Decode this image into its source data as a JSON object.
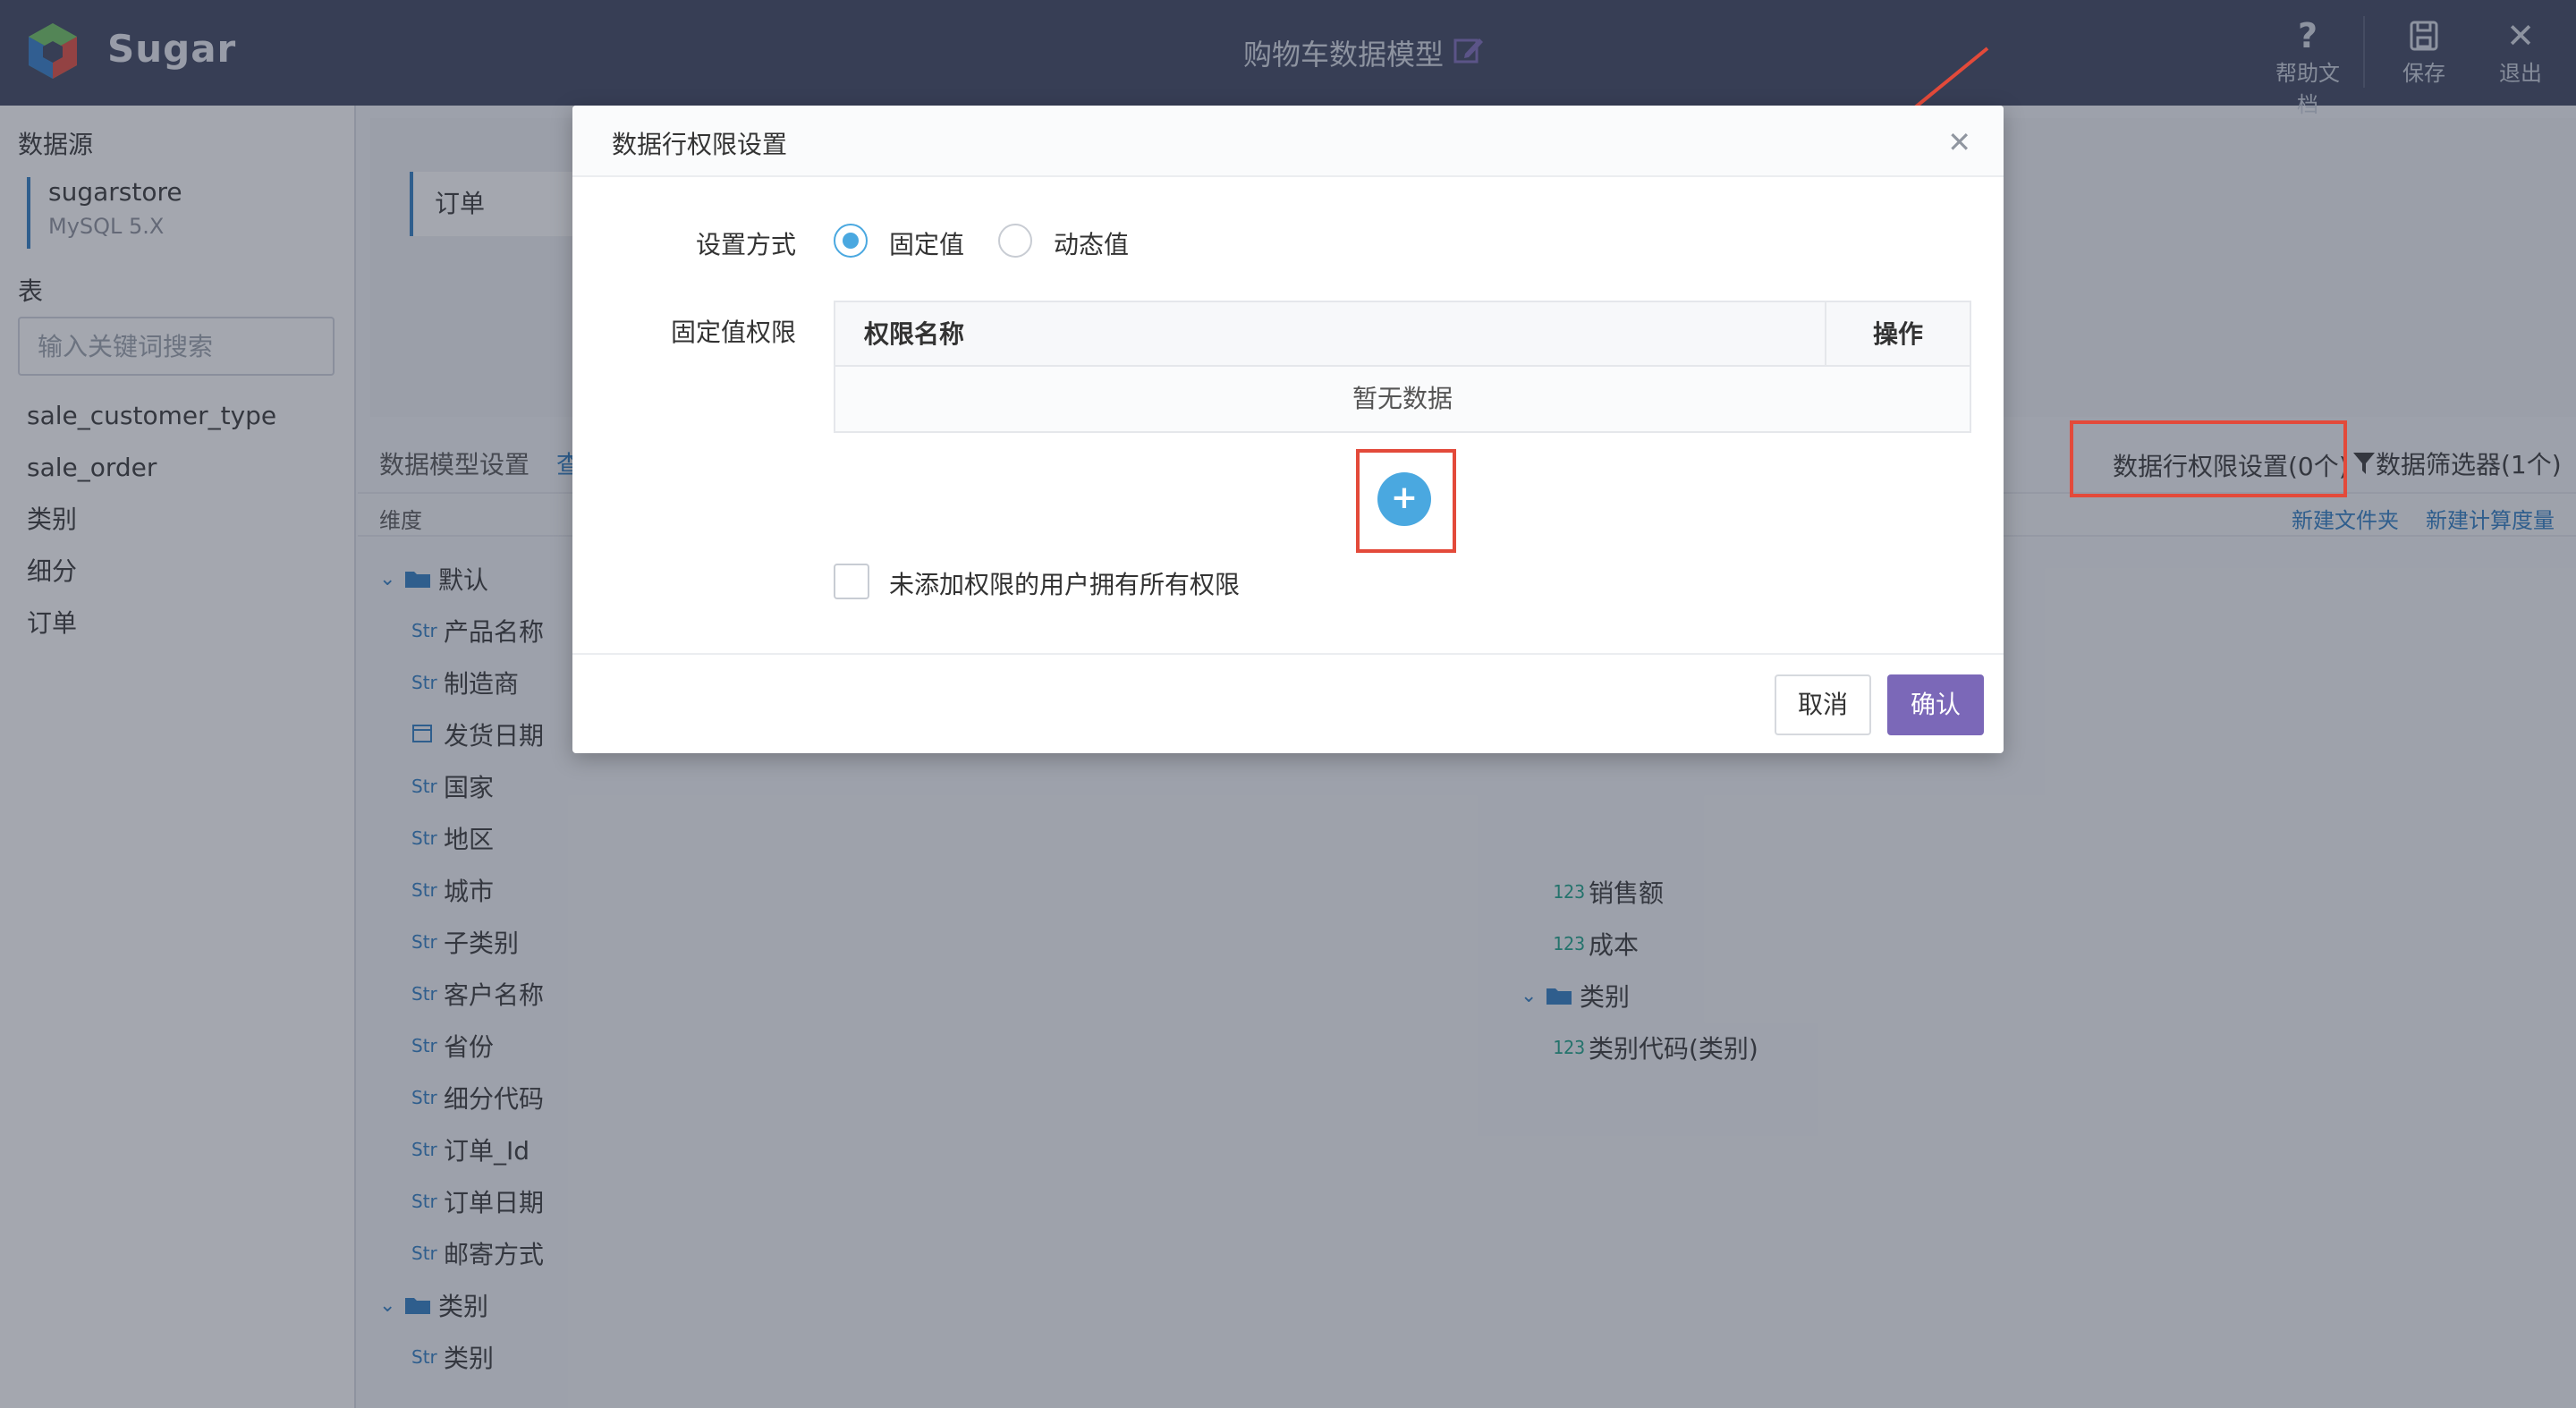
{
  "app": {
    "brand": "Sugar"
  },
  "header": {
    "model_title": "购物车数据模型",
    "actions": [
      {
        "icon": "question-icon",
        "label": "帮助文档"
      },
      {
        "icon": "save-icon",
        "label": "保存"
      },
      {
        "icon": "close-icon",
        "label": "退出"
      }
    ]
  },
  "sidebar": {
    "datasource_title": "数据源",
    "datasource_name": "sugarstore",
    "datasource_type": "MySQL 5.X",
    "tables_title": "表",
    "search_placeholder": "输入关键词搜索",
    "tables": [
      "sale_customer_type",
      "sale_order",
      "类别",
      "细分",
      "订单"
    ]
  },
  "main": {
    "tab_label": "订单",
    "model_settings": "数据模型设置",
    "model_settings_link": "查",
    "row_permission": "数据行权限设置(0个)",
    "data_filter": "数据筛选器(1个)",
    "dimension_label": "维度",
    "new_folder": "新建文件夹",
    "new_measure": "新建计算度量",
    "dim_tree": {
      "folder_default": "默认",
      "fields": [
        {
          "type": "Str",
          "label": "产品名称"
        },
        {
          "type": "Str",
          "label": "制造商"
        },
        {
          "type": "date",
          "label": "发货日期"
        },
        {
          "type": "Str",
          "label": "国家"
        },
        {
          "type": "Str",
          "label": "地区"
        },
        {
          "type": "Str",
          "label": "城市"
        },
        {
          "type": "Str",
          "label": "子类别"
        },
        {
          "type": "Str",
          "label": "客户名称"
        },
        {
          "type": "Str",
          "label": "省份"
        },
        {
          "type": "Str",
          "label": "细分代码"
        },
        {
          "type": "Str",
          "label": "订单_Id"
        },
        {
          "type": "Str",
          "label": "订单日期"
        },
        {
          "type": "Str",
          "label": "邮寄方式"
        }
      ],
      "folder_category": "类别",
      "category_fields": [
        {
          "type": "Str",
          "label": "类别"
        }
      ]
    },
    "measure_tree": {
      "fields": [
        {
          "type": "123",
          "label": "销售额"
        },
        {
          "type": "123",
          "label": "成本"
        }
      ],
      "folder_category": "类别",
      "category_fields": [
        {
          "type": "123",
          "label": "类别代码(类别)"
        }
      ]
    }
  },
  "modal": {
    "title": "数据行权限设置",
    "mode_label": "设置方式",
    "option_fixed": "固定值",
    "option_dynamic": "动态值",
    "fixed_label": "固定值权限",
    "col_name": "权限名称",
    "col_action": "操作",
    "empty_text": "暂无数据",
    "add_symbol": "+",
    "checkbox_label": "未添加权限的用户拥有所有权限",
    "cancel": "取消",
    "confirm": "确认"
  },
  "colors": {
    "header_bg": "#39415c",
    "accent_blue": "#4aa8e0",
    "confirm_purple": "#7b68b8",
    "highlight_red": "#e34a3a"
  }
}
